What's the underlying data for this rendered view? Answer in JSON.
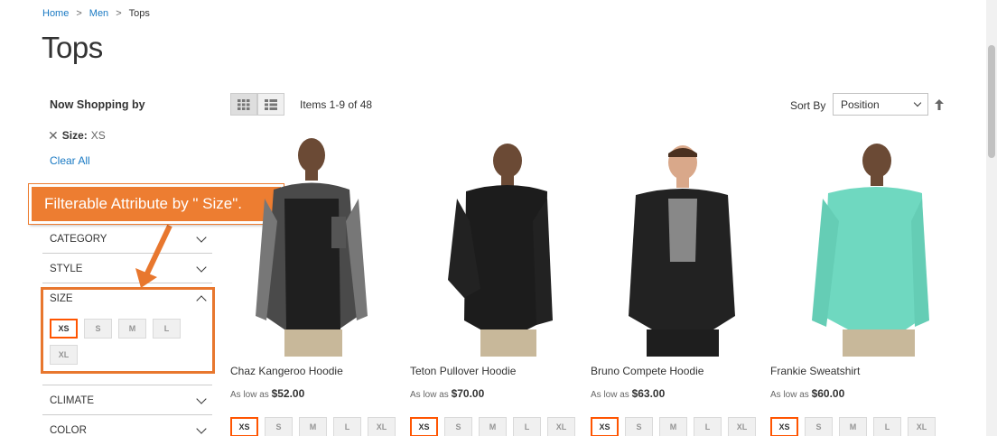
{
  "breadcrumb": {
    "items": [
      "Home",
      "Men"
    ],
    "current": "Tops",
    "separator": ">"
  },
  "page_title": "Tops",
  "sidebar": {
    "shop_by_title": "Now Shopping by",
    "current_filter": {
      "label": "Size:",
      "value": "XS",
      "remove_icon": "close-icon"
    },
    "clear_all": "Clear All",
    "filters": {
      "category": "CATEGORY",
      "style": "STYLE",
      "size": "SIZE",
      "climate": "CLIMATE",
      "color": "COLOR"
    },
    "size_options": [
      "XS",
      "S",
      "M",
      "L",
      "XL"
    ],
    "selected_size": "XS"
  },
  "annotation": {
    "text": "Filterable Attribute by \" Size\".",
    "color": "#ed7d31"
  },
  "toolbar": {
    "view_modes": [
      "grid-icon",
      "list-icon"
    ],
    "items_count": "Items 1-9 of 48",
    "sort_label": "Sort By",
    "sort_value": "Position",
    "sort_direction_icon": "arrow-up-icon"
  },
  "products": [
    {
      "name": "Chaz Kangeroo Hoodie",
      "price_prefix": "As low as",
      "price": "$52.00",
      "sizes": [
        "XS",
        "S",
        "M",
        "L",
        "XL"
      ]
    },
    {
      "name": "Teton Pullover Hoodie",
      "price_prefix": "As low as",
      "price": "$70.00",
      "sizes": [
        "XS",
        "S",
        "M",
        "L",
        "XL"
      ]
    },
    {
      "name": "Bruno Compete Hoodie",
      "price_prefix": "As low as",
      "price": "$63.00",
      "sizes": [
        "XS",
        "S",
        "M",
        "L",
        "XL"
      ]
    },
    {
      "name": "Frankie Sweatshirt",
      "price_prefix": "As low as",
      "price": "$60.00",
      "sizes": [
        "XS",
        "S",
        "M",
        "L",
        "XL"
      ]
    }
  ],
  "colors": {
    "link": "#1979c3",
    "accent": "#ff5501"
  }
}
